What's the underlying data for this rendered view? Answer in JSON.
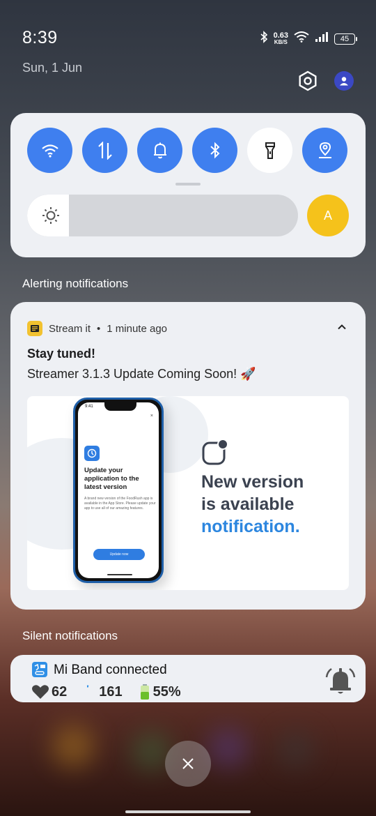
{
  "status_bar": {
    "time": "8:39",
    "date": "Sun, 1 Jun",
    "net_speed_value": "0.63",
    "net_speed_unit": "KB/S",
    "battery_level": "45"
  },
  "quick_settings": {
    "tiles": [
      {
        "icon": "wifi-icon",
        "state": "on"
      },
      {
        "icon": "mobile-data-icon",
        "state": "on"
      },
      {
        "icon": "bell-icon",
        "state": "on"
      },
      {
        "icon": "bluetooth-icon",
        "state": "on"
      },
      {
        "icon": "flashlight-icon",
        "state": "off"
      },
      {
        "icon": "location-icon",
        "state": "on"
      }
    ],
    "brightness_level": 0.155,
    "auto_brightness_label": "A",
    "accent_color": "#3f7fef",
    "auto_color": "#f5c21b"
  },
  "sections": {
    "alerting_label": "Alerting notifications",
    "silent_label": "Silent notifications"
  },
  "alert_notification": {
    "app_name": "Stream it",
    "separator": "•",
    "time_ago": "1 minute ago",
    "title": "Stay tuned!",
    "body": "Streamer 3.1.3 Update Coming Soon! 🚀",
    "promo": {
      "phone_time": "9:41",
      "phone_close": "×",
      "phone_heading": "Update your application to the latest version",
      "phone_text": "A brand new version of the FoodRush app is available in the App Store. Please update your app to use all of our amazing features.",
      "phone_button": "Update now",
      "headline_line1": "New version",
      "headline_line2": "is available",
      "headline_line3": "notification."
    }
  },
  "silent_notification": {
    "title": "Mi Band connected",
    "heart_rate": "62",
    "steps": "161",
    "battery": "55%"
  }
}
